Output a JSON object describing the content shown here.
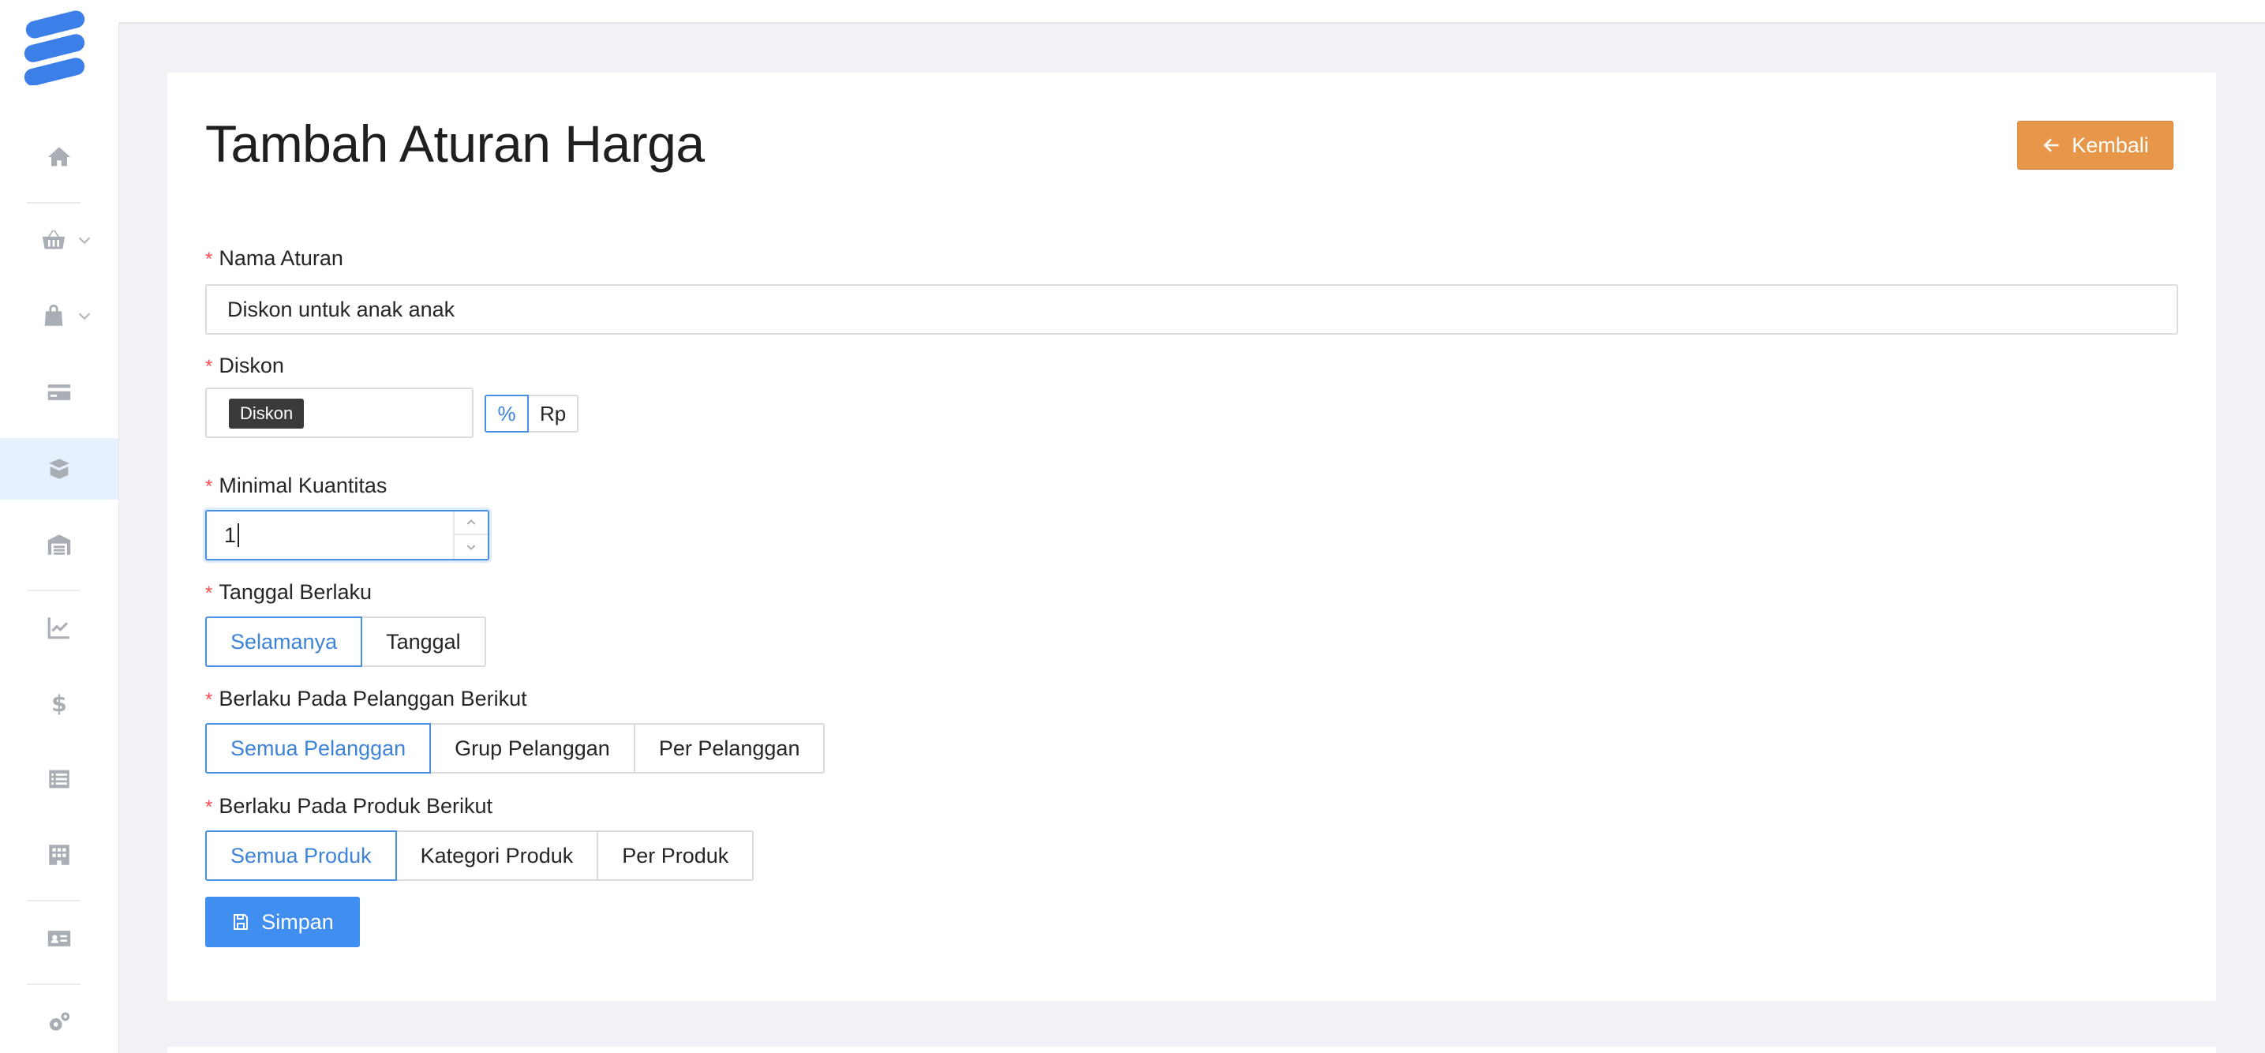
{
  "page": {
    "title": "Tambah Aturan Harga",
    "back_label": "Kembali",
    "save_label": "Simpan"
  },
  "colors": {
    "accent": "#3f8ef0",
    "back_button": "#e8964a",
    "required": "#ff4d4f"
  },
  "sidebar": {
    "items": [
      {
        "icon": "home-icon"
      },
      {
        "icon": "basket-icon",
        "has_submenu": true
      },
      {
        "icon": "shopping-bag-icon",
        "has_submenu": true
      },
      {
        "icon": "credit-card-icon"
      },
      {
        "icon": "box-open-icon",
        "active": true
      },
      {
        "icon": "warehouse-icon"
      },
      {
        "icon": "chart-line-icon"
      },
      {
        "icon": "dollar-icon"
      },
      {
        "icon": "list-icon"
      },
      {
        "icon": "building-icon"
      },
      {
        "icon": "id-card-icon"
      },
      {
        "icon": "gears-icon"
      }
    ]
  },
  "form": {
    "required_mark": "*",
    "nama_aturan": {
      "label": "Nama Aturan",
      "value": "Diskon untuk anak anak"
    },
    "diskon": {
      "label": "Diskon",
      "tooltip": "Diskon",
      "units": [
        "%",
        "Rp"
      ],
      "selected_unit": "%"
    },
    "minimal_kuantitas": {
      "label": "Minimal Kuantitas",
      "value": "1"
    },
    "tanggal_berlaku": {
      "label": "Tanggal Berlaku",
      "options": [
        "Selamanya",
        "Tanggal"
      ],
      "selected": "Selamanya"
    },
    "pelanggan": {
      "label": "Berlaku Pada Pelanggan Berikut",
      "options": [
        "Semua Pelanggan",
        "Grup Pelanggan",
        "Per Pelanggan"
      ],
      "selected": "Semua Pelanggan"
    },
    "produk": {
      "label": "Berlaku Pada Produk Berikut",
      "options": [
        "Semua Produk",
        "Kategori Produk",
        "Per Produk"
      ],
      "selected": "Semua Produk"
    }
  }
}
